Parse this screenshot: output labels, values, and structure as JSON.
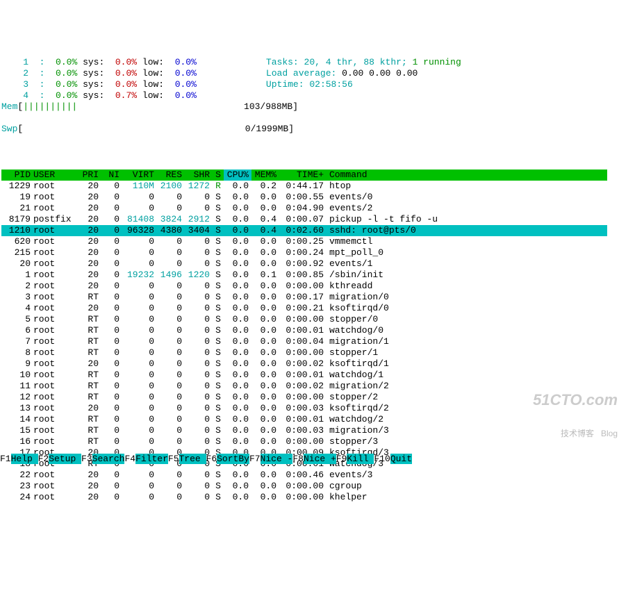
{
  "header": {
    "cpus": [
      {
        "id": "1",
        "user": "0.0%",
        "sys": "0.0%",
        "low": "0.0%"
      },
      {
        "id": "2",
        "user": "0.0%",
        "sys": "0.0%",
        "low": "0.0%"
      },
      {
        "id": "3",
        "user": "0.0%",
        "sys": "0.0%",
        "low": "0.0%"
      },
      {
        "id": "4",
        "user": "0.0%",
        "sys": "0.7%",
        "low": "0.0%"
      }
    ],
    "mem_label": "Mem",
    "mem_bar": "||||||||||",
    "mem_text": "103/988MB",
    "swp_label": "Swp",
    "swp_bar": "",
    "swp_text": "0/1999MB",
    "tasks_label": "Tasks: ",
    "tasks_value": "20, 4 thr, 88 kthr; ",
    "tasks_running": "1 running",
    "loadavg_label": "Load average: ",
    "loadavg_values": "0.00 0.00 0.00",
    "uptime_label": "Uptime: ",
    "uptime_value": "02:58:56"
  },
  "columns": {
    "pid": "PID",
    "user": "USER",
    "pri": "PRI",
    "ni": "NI",
    "virt": "VIRT",
    "res": "RES",
    "shr": "SHR",
    "s": "S",
    "cpu": "CPU%",
    "mem": "MEM%",
    "time": "TIME+",
    "cmd": "Command"
  },
  "processes": [
    {
      "pid": "1229",
      "user": "root",
      "pri": "20",
      "ni": "0",
      "virt": "110M",
      "res": "2100",
      "shr": "1272",
      "s": "R",
      "cpu": "0.0",
      "mem": "0.2",
      "time": "0:44.17",
      "cmd": "htop",
      "virt_c": "cyan",
      "res_c": "cyan",
      "shr_c": "cyan",
      "s_c": "green"
    },
    {
      "pid": "19",
      "user": "root",
      "pri": "20",
      "ni": "0",
      "virt": "0",
      "res": "0",
      "shr": "0",
      "s": "S",
      "cpu": "0.0",
      "mem": "0.0",
      "time": "0:00.55",
      "cmd": "events/0"
    },
    {
      "pid": "21",
      "user": "root",
      "pri": "20",
      "ni": "0",
      "virt": "0",
      "res": "0",
      "shr": "0",
      "s": "S",
      "cpu": "0.0",
      "mem": "0.0",
      "time": "0:04.90",
      "cmd": "events/2"
    },
    {
      "pid": "8179",
      "user": "postfix",
      "pri": "20",
      "ni": "0",
      "virt": "81408",
      "res": "3824",
      "shr": "2912",
      "s": "S",
      "cpu": "0.0",
      "mem": "0.4",
      "time": "0:00.07",
      "cmd": "pickup -l -t fifo -u",
      "virt_c": "cyan",
      "res_c": "cyan",
      "shr_c": "cyan"
    },
    {
      "pid": "1210",
      "user": "root",
      "pri": "20",
      "ni": "0",
      "virt": "96328",
      "res": "4380",
      "shr": "3404",
      "s": "S",
      "cpu": "0.0",
      "mem": "0.4",
      "time": "0:02.60",
      "cmd": "sshd: root@pts/0",
      "hl": true
    },
    {
      "pid": "620",
      "user": "root",
      "pri": "20",
      "ni": "0",
      "virt": "0",
      "res": "0",
      "shr": "0",
      "s": "S",
      "cpu": "0.0",
      "mem": "0.0",
      "time": "0:00.25",
      "cmd": "vmmemctl"
    },
    {
      "pid": "215",
      "user": "root",
      "pri": "20",
      "ni": "0",
      "virt": "0",
      "res": "0",
      "shr": "0",
      "s": "S",
      "cpu": "0.0",
      "mem": "0.0",
      "time": "0:00.24",
      "cmd": "mpt_poll_0"
    },
    {
      "pid": "20",
      "user": "root",
      "pri": "20",
      "ni": "0",
      "virt": "0",
      "res": "0",
      "shr": "0",
      "s": "S",
      "cpu": "0.0",
      "mem": "0.0",
      "time": "0:00.92",
      "cmd": "events/1"
    },
    {
      "pid": "1",
      "user": "root",
      "pri": "20",
      "ni": "0",
      "virt": "19232",
      "res": "1496",
      "shr": "1220",
      "s": "S",
      "cpu": "0.0",
      "mem": "0.1",
      "time": "0:00.85",
      "cmd": "/sbin/init",
      "virt_c": "cyan",
      "res_c": "cyan",
      "shr_c": "cyan"
    },
    {
      "pid": "2",
      "user": "root",
      "pri": "20",
      "ni": "0",
      "virt": "0",
      "res": "0",
      "shr": "0",
      "s": "S",
      "cpu": "0.0",
      "mem": "0.0",
      "time": "0:00.00",
      "cmd": "kthreadd"
    },
    {
      "pid": "3",
      "user": "root",
      "pri": "RT",
      "ni": "0",
      "virt": "0",
      "res": "0",
      "shr": "0",
      "s": "S",
      "cpu": "0.0",
      "mem": "0.0",
      "time": "0:00.17",
      "cmd": "migration/0"
    },
    {
      "pid": "4",
      "user": "root",
      "pri": "20",
      "ni": "0",
      "virt": "0",
      "res": "0",
      "shr": "0",
      "s": "S",
      "cpu": "0.0",
      "mem": "0.0",
      "time": "0:00.21",
      "cmd": "ksoftirqd/0"
    },
    {
      "pid": "5",
      "user": "root",
      "pri": "RT",
      "ni": "0",
      "virt": "0",
      "res": "0",
      "shr": "0",
      "s": "S",
      "cpu": "0.0",
      "mem": "0.0",
      "time": "0:00.00",
      "cmd": "stopper/0"
    },
    {
      "pid": "6",
      "user": "root",
      "pri": "RT",
      "ni": "0",
      "virt": "0",
      "res": "0",
      "shr": "0",
      "s": "S",
      "cpu": "0.0",
      "mem": "0.0",
      "time": "0:00.01",
      "cmd": "watchdog/0"
    },
    {
      "pid": "7",
      "user": "root",
      "pri": "RT",
      "ni": "0",
      "virt": "0",
      "res": "0",
      "shr": "0",
      "s": "S",
      "cpu": "0.0",
      "mem": "0.0",
      "time": "0:00.04",
      "cmd": "migration/1"
    },
    {
      "pid": "8",
      "user": "root",
      "pri": "RT",
      "ni": "0",
      "virt": "0",
      "res": "0",
      "shr": "0",
      "s": "S",
      "cpu": "0.0",
      "mem": "0.0",
      "time": "0:00.00",
      "cmd": "stopper/1"
    },
    {
      "pid": "9",
      "user": "root",
      "pri": "20",
      "ni": "0",
      "virt": "0",
      "res": "0",
      "shr": "0",
      "s": "S",
      "cpu": "0.0",
      "mem": "0.0",
      "time": "0:00.02",
      "cmd": "ksoftirqd/1"
    },
    {
      "pid": "10",
      "user": "root",
      "pri": "RT",
      "ni": "0",
      "virt": "0",
      "res": "0",
      "shr": "0",
      "s": "S",
      "cpu": "0.0",
      "mem": "0.0",
      "time": "0:00.01",
      "cmd": "watchdog/1"
    },
    {
      "pid": "11",
      "user": "root",
      "pri": "RT",
      "ni": "0",
      "virt": "0",
      "res": "0",
      "shr": "0",
      "s": "S",
      "cpu": "0.0",
      "mem": "0.0",
      "time": "0:00.02",
      "cmd": "migration/2"
    },
    {
      "pid": "12",
      "user": "root",
      "pri": "RT",
      "ni": "0",
      "virt": "0",
      "res": "0",
      "shr": "0",
      "s": "S",
      "cpu": "0.0",
      "mem": "0.0",
      "time": "0:00.00",
      "cmd": "stopper/2"
    },
    {
      "pid": "13",
      "user": "root",
      "pri": "20",
      "ni": "0",
      "virt": "0",
      "res": "0",
      "shr": "0",
      "s": "S",
      "cpu": "0.0",
      "mem": "0.0",
      "time": "0:00.03",
      "cmd": "ksoftirqd/2"
    },
    {
      "pid": "14",
      "user": "root",
      "pri": "RT",
      "ni": "0",
      "virt": "0",
      "res": "0",
      "shr": "0",
      "s": "S",
      "cpu": "0.0",
      "mem": "0.0",
      "time": "0:00.01",
      "cmd": "watchdog/2"
    },
    {
      "pid": "15",
      "user": "root",
      "pri": "RT",
      "ni": "0",
      "virt": "0",
      "res": "0",
      "shr": "0",
      "s": "S",
      "cpu": "0.0",
      "mem": "0.0",
      "time": "0:00.03",
      "cmd": "migration/3"
    },
    {
      "pid": "16",
      "user": "root",
      "pri": "RT",
      "ni": "0",
      "virt": "0",
      "res": "0",
      "shr": "0",
      "s": "S",
      "cpu": "0.0",
      "mem": "0.0",
      "time": "0:00.00",
      "cmd": "stopper/3"
    },
    {
      "pid": "17",
      "user": "root",
      "pri": "20",
      "ni": "0",
      "virt": "0",
      "res": "0",
      "shr": "0",
      "s": "S",
      "cpu": "0.0",
      "mem": "0.0",
      "time": "0:00.09",
      "cmd": "ksoftirqd/3"
    },
    {
      "pid": "18",
      "user": "root",
      "pri": "RT",
      "ni": "0",
      "virt": "0",
      "res": "0",
      "shr": "0",
      "s": "S",
      "cpu": "0.0",
      "mem": "0.0",
      "time": "0:00.01",
      "cmd": "watchdog/3"
    },
    {
      "pid": "22",
      "user": "root",
      "pri": "20",
      "ni": "0",
      "virt": "0",
      "res": "0",
      "shr": "0",
      "s": "S",
      "cpu": "0.0",
      "mem": "0.0",
      "time": "0:00.46",
      "cmd": "events/3"
    },
    {
      "pid": "23",
      "user": "root",
      "pri": "20",
      "ni": "0",
      "virt": "0",
      "res": "0",
      "shr": "0",
      "s": "S",
      "cpu": "0.0",
      "mem": "0.0",
      "time": "0:00.00",
      "cmd": "cgroup"
    },
    {
      "pid": "24",
      "user": "root",
      "pri": "20",
      "ni": "0",
      "virt": "0",
      "res": "0",
      "shr": "0",
      "s": "S",
      "cpu": "0.0",
      "mem": "0.0",
      "time": "0:00.00",
      "cmd": "khelper"
    }
  ],
  "fkeys": [
    {
      "k": "F1",
      "l": "Help "
    },
    {
      "k": "F2",
      "l": "Setup "
    },
    {
      "k": "F3",
      "l": "Search"
    },
    {
      "k": "F4",
      "l": "Filter"
    },
    {
      "k": "F5",
      "l": "Tree  "
    },
    {
      "k": "F6",
      "l": "SortBy"
    },
    {
      "k": "F7",
      "l": "Nice -"
    },
    {
      "k": "F8",
      "l": "Nice +"
    },
    {
      "k": "F9",
      "l": "Kill  "
    },
    {
      "k": "F10",
      "l": "Quit  "
    }
  ],
  "watermark": {
    "big": "51CTO.com",
    "small": "技术博客   Blog"
  }
}
